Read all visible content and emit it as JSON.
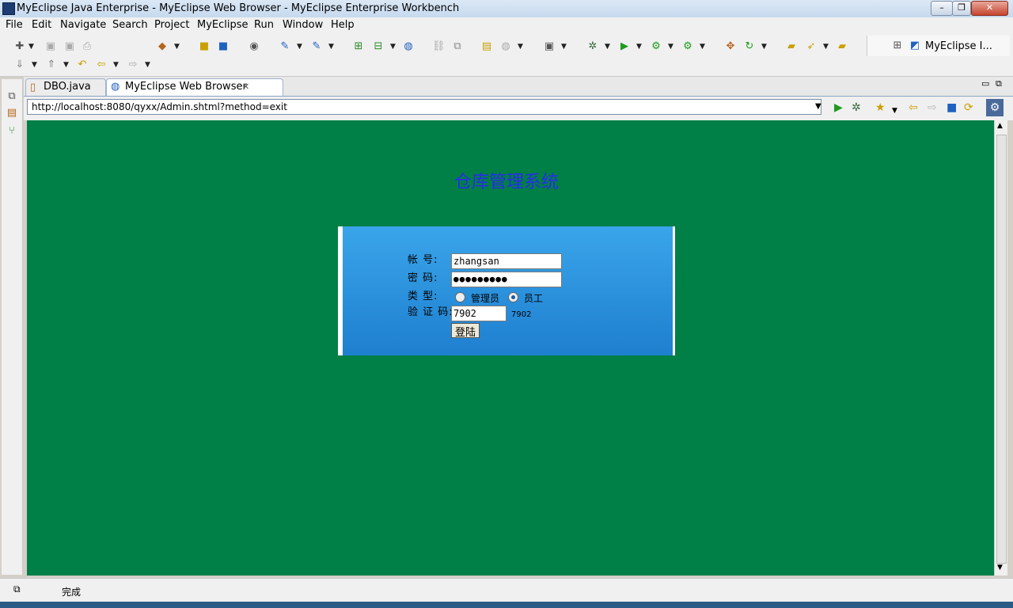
{
  "window": {
    "title": "MyEclipse Java Enterprise - MyEclipse Web Browser - MyEclipse Enterprise Workbench"
  },
  "menu": [
    "File",
    "Edit",
    "Navigate",
    "Search",
    "Project",
    "MyEclipse",
    "Run",
    "Window",
    "Help"
  ],
  "perspective": {
    "label": "MyEclipse I..."
  },
  "tabs": [
    {
      "label": "DBO.java",
      "icon": "java-file-icon"
    },
    {
      "label": "MyEclipse Web Browser",
      "icon": "globe-icon"
    }
  ],
  "browser": {
    "url": "http://localhost:8080/qyxx/Admin.shtml?method=exit"
  },
  "page": {
    "heading": "仓库管理系统",
    "form": {
      "account_label": "帐     号:",
      "account_value": "zhangsan",
      "password_label": "密     码:",
      "password_value": "●●●●●●●●●",
      "type_label": "类     型:",
      "type_options": [
        "管理员",
        "员工"
      ],
      "type_selected": "员工",
      "captcha_label": "验 证 码:",
      "captcha_value": "7902",
      "captcha_code": "7902",
      "submit_label": "登陆"
    }
  },
  "status": {
    "text": "完成"
  },
  "colors": {
    "page_background": "#007f46",
    "heading": "#2a2af0",
    "login_box": "#2b8fdd"
  }
}
